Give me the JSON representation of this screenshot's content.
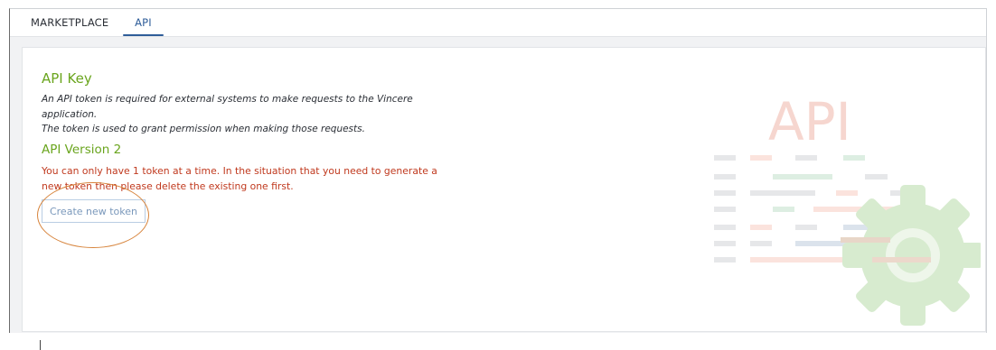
{
  "tabs": [
    {
      "label": "MARKETPLACE",
      "active": false
    },
    {
      "label": "API",
      "active": true
    }
  ],
  "api_key": {
    "title": "API Key",
    "description_lines": [
      "An API token is required for external systems to make requests to the Vincere application.",
      "The token is used to grant permission when making those requests."
    ]
  },
  "api_version": {
    "title": "API Version 2",
    "warning": "You can only have 1 token at a time. In the situation that you need to generate a new token then please delete the existing one first.",
    "create_button_label": "Create new token"
  },
  "illustration": {
    "label": "API",
    "icon": "gear-icon",
    "colors": {
      "text": "#f6d6cf",
      "gear": "#d7ebcf",
      "gray": "#e6e7e9"
    }
  },
  "colors": {
    "accent": "#2f5d99",
    "heading": "#6aa51e",
    "warning": "#c0391e",
    "annotation": "#d7843c"
  }
}
